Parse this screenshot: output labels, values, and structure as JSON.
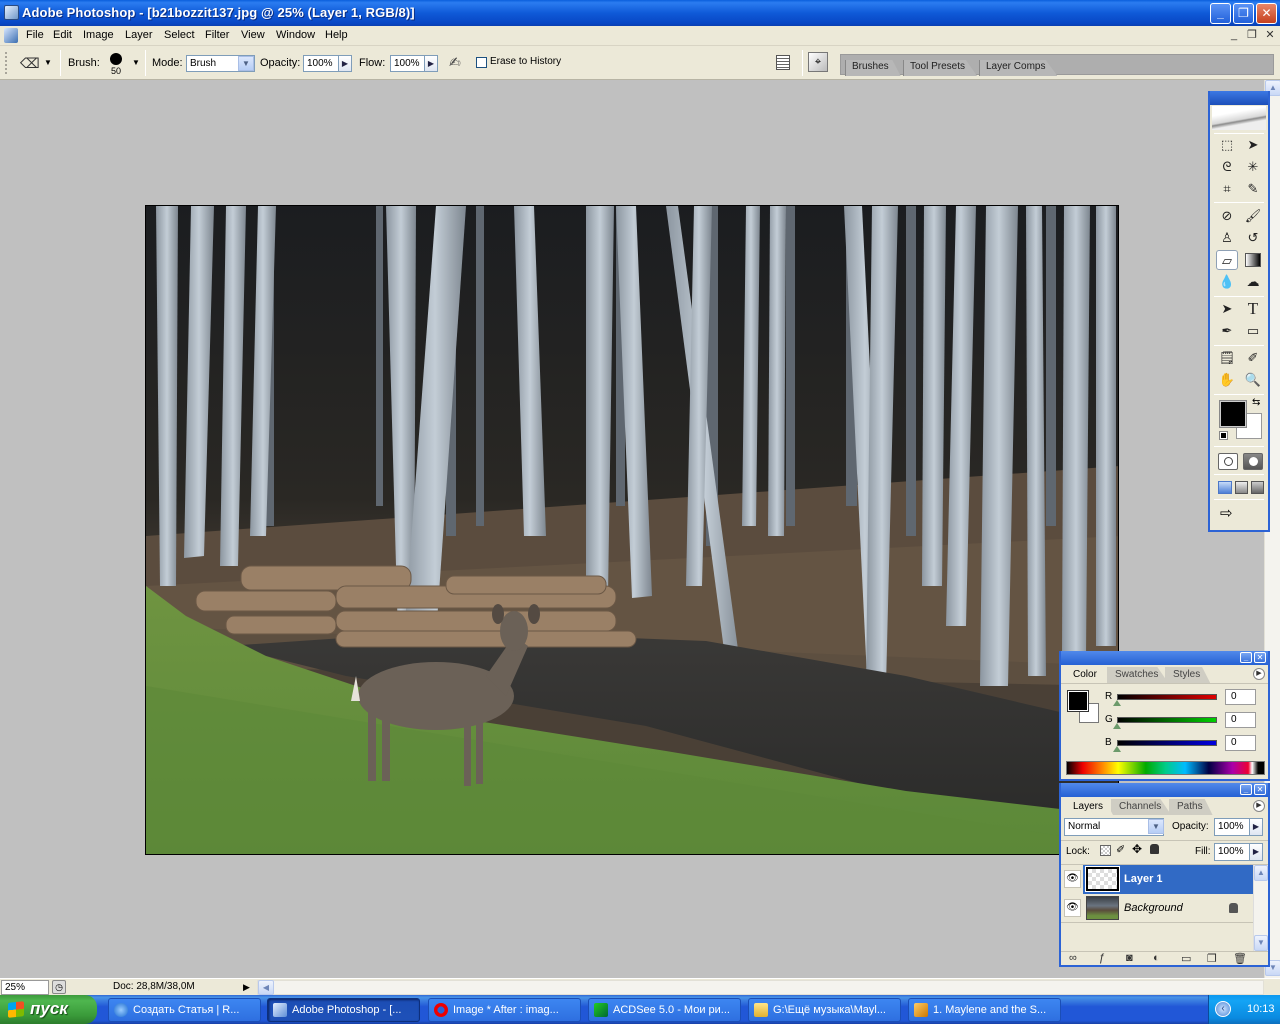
{
  "window": {
    "title": "Adobe Photoshop - [b21bozzit137.jpg @ 25% (Layer 1, RGB/8)]",
    "controls": {
      "minimize": "_",
      "maximize": "❐",
      "close": "✕"
    }
  },
  "menu": {
    "items": [
      "File",
      "Edit",
      "Image",
      "Layer",
      "Select",
      "Filter",
      "View",
      "Window",
      "Help"
    ],
    "doc_controls": {
      "minimize": "_",
      "restore": "❐",
      "close": "✕"
    }
  },
  "options_bar": {
    "tool_icon": "eraser-icon",
    "brush_label": "Brush:",
    "brush_size": "50",
    "mode_label": "Mode:",
    "mode_value": "Brush",
    "opacity_label": "Opacity:",
    "opacity_value": "100%",
    "flow_label": "Flow:",
    "flow_value": "100%",
    "erase_to_history_label": "Erase to History",
    "erase_to_history_checked": false,
    "palette_well_tabs": [
      "Brushes",
      "Tool Presets",
      "Layer Comps"
    ]
  },
  "canvas": {
    "image_description": "Forest of pale cedar trunks, stacked logs, a stream and a white-tailed deer standing on green grass"
  },
  "toolbox": {
    "tools": [
      [
        "marquee-icon",
        "move-icon"
      ],
      [
        "lasso-icon",
        "magic-wand-icon"
      ],
      [
        "crop-icon",
        "slice-icon"
      ],
      [
        "healing-brush-icon",
        "brush-icon"
      ],
      [
        "clone-stamp-icon",
        "history-brush-icon"
      ],
      [
        "eraser-icon",
        "gradient-icon"
      ],
      [
        "blur-icon",
        "dodge-icon"
      ],
      [
        "path-selection-icon",
        "type-icon"
      ],
      [
        "pen-icon",
        "rectangle-icon"
      ],
      [
        "notes-icon",
        "eyedropper-icon"
      ],
      [
        "hand-icon",
        "zoom-icon"
      ]
    ],
    "selected_tool": "eraser-icon",
    "foreground_color": "#000000",
    "background_color": "#ffffff"
  },
  "color_panel": {
    "tabs": [
      "Color",
      "Swatches",
      "Styles"
    ],
    "active_tab": "Color",
    "channels": [
      {
        "label": "R",
        "value": "0",
        "color": "#e00000"
      },
      {
        "label": "G",
        "value": "0",
        "color": "#00d000"
      },
      {
        "label": "B",
        "value": "0",
        "color": "#0000e0"
      }
    ]
  },
  "layers_panel": {
    "tabs": [
      "Layers",
      "Channels",
      "Paths"
    ],
    "active_tab": "Layers",
    "blend_mode": "Normal",
    "opacity_label": "Opacity:",
    "opacity_value": "100%",
    "lock_label": "Lock:",
    "fill_label": "Fill:",
    "fill_value": "100%",
    "layers": [
      {
        "name": "Layer 1",
        "visible": true,
        "selected": true,
        "locked": false
      },
      {
        "name": "Background",
        "visible": true,
        "selected": false,
        "locked": true
      }
    ],
    "footer_icons": [
      "link-icon",
      "layer-style-icon",
      "mask-icon",
      "adjustment-layer-icon",
      "new-group-icon",
      "new-layer-icon",
      "trash-icon"
    ]
  },
  "status_bar": {
    "zoom": "25%",
    "doc_info": "Doc: 28,8M/38,0M"
  },
  "taskbar": {
    "start_label": "пуск",
    "tasks": [
      {
        "label": "Создать Статья | R...",
        "icon": "ie-icon",
        "active": false
      },
      {
        "label": "Adobe Photoshop - [...",
        "icon": "photoshop-icon",
        "active": true
      },
      {
        "label": "Image * After : imag...",
        "icon": "opera-icon",
        "active": false
      },
      {
        "label": "ACDSee 5.0 - Мои ри...",
        "icon": "acdsee-icon",
        "active": false
      },
      {
        "label": "G:\\Ещё музыка\\Mayl...",
        "icon": "folder-icon",
        "active": false
      },
      {
        "label": "1. Maylene and the S...",
        "icon": "winamp-icon",
        "active": false
      }
    ],
    "clock": "10:13"
  }
}
